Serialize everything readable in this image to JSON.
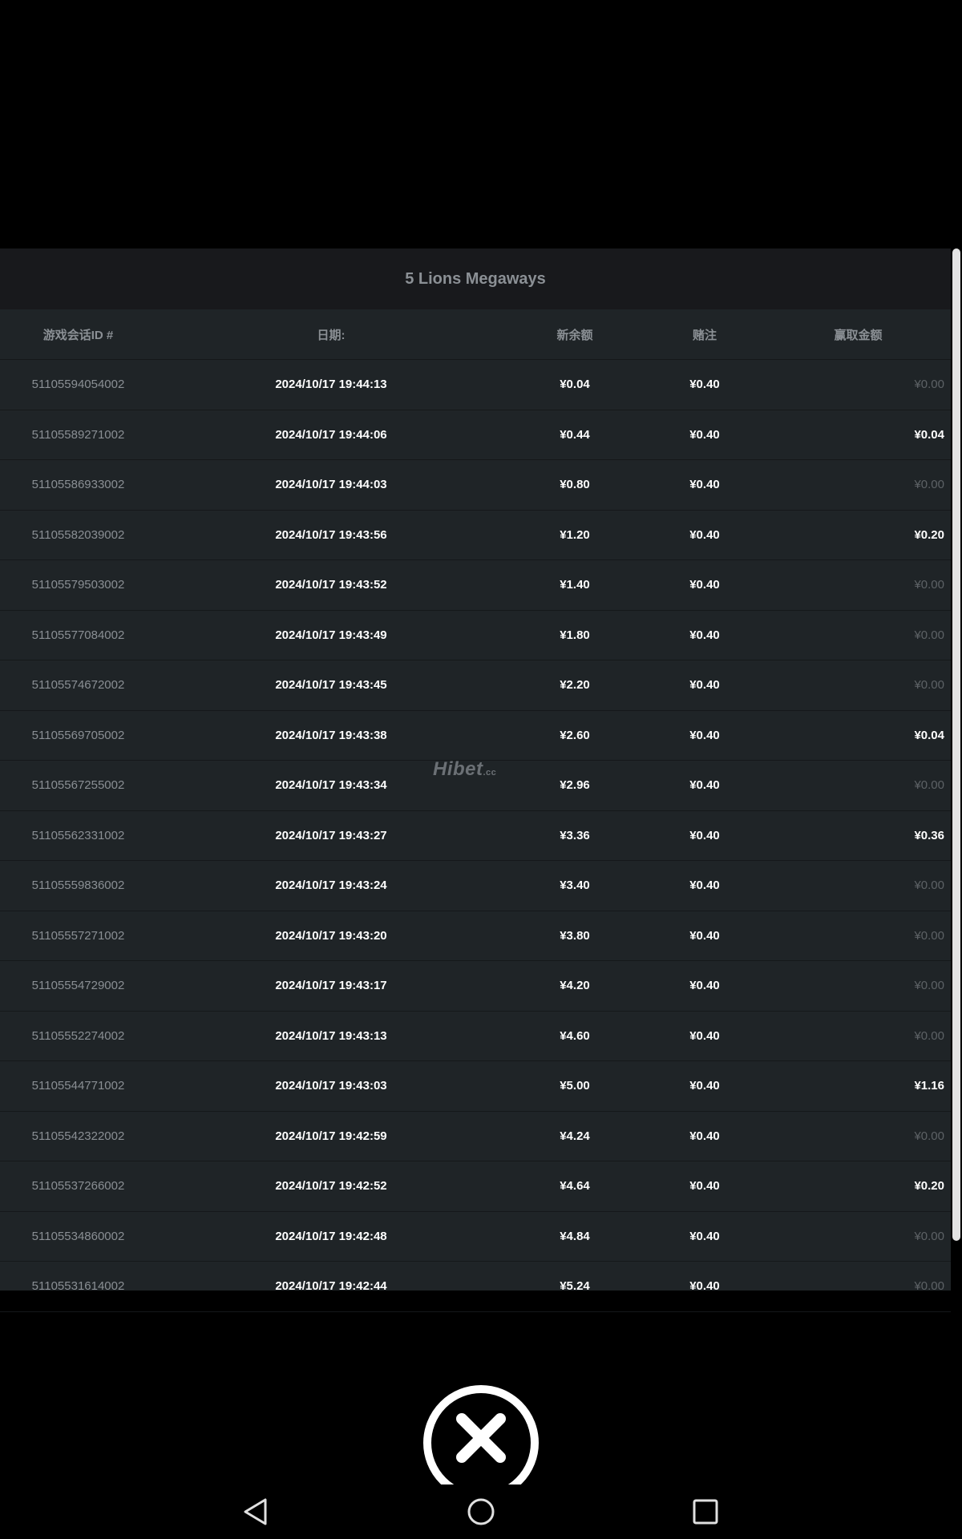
{
  "panel": {
    "title": "5 Lions Megaways"
  },
  "table": {
    "headers": {
      "session_id": "游戏会话ID #",
      "date": "日期:",
      "new_balance": "新余额",
      "bet": "赌注",
      "win": "赢取金额"
    },
    "rows": [
      {
        "id": "51105594054002",
        "date": "2024/10/17 19:44:13",
        "balance": "¥0.04",
        "bet": "¥0.40",
        "win": "¥0.00"
      },
      {
        "id": "51105589271002",
        "date": "2024/10/17 19:44:06",
        "balance": "¥0.44",
        "bet": "¥0.40",
        "win": "¥0.04"
      },
      {
        "id": "51105586933002",
        "date": "2024/10/17 19:44:03",
        "balance": "¥0.80",
        "bet": "¥0.40",
        "win": "¥0.00"
      },
      {
        "id": "51105582039002",
        "date": "2024/10/17 19:43:56",
        "balance": "¥1.20",
        "bet": "¥0.40",
        "win": "¥0.20"
      },
      {
        "id": "51105579503002",
        "date": "2024/10/17 19:43:52",
        "balance": "¥1.40",
        "bet": "¥0.40",
        "win": "¥0.00"
      },
      {
        "id": "51105577084002",
        "date": "2024/10/17 19:43:49",
        "balance": "¥1.80",
        "bet": "¥0.40",
        "win": "¥0.00"
      },
      {
        "id": "51105574672002",
        "date": "2024/10/17 19:43:45",
        "balance": "¥2.20",
        "bet": "¥0.40",
        "win": "¥0.00"
      },
      {
        "id": "51105569705002",
        "date": "2024/10/17 19:43:38",
        "balance": "¥2.60",
        "bet": "¥0.40",
        "win": "¥0.04"
      },
      {
        "id": "51105567255002",
        "date": "2024/10/17 19:43:34",
        "balance": "¥2.96",
        "bet": "¥0.40",
        "win": "¥0.00"
      },
      {
        "id": "51105562331002",
        "date": "2024/10/17 19:43:27",
        "balance": "¥3.36",
        "bet": "¥0.40",
        "win": "¥0.36"
      },
      {
        "id": "51105559836002",
        "date": "2024/10/17 19:43:24",
        "balance": "¥3.40",
        "bet": "¥0.40",
        "win": "¥0.00"
      },
      {
        "id": "51105557271002",
        "date": "2024/10/17 19:43:20",
        "balance": "¥3.80",
        "bet": "¥0.40",
        "win": "¥0.00"
      },
      {
        "id": "51105554729002",
        "date": "2024/10/17 19:43:17",
        "balance": "¥4.20",
        "bet": "¥0.40",
        "win": "¥0.00"
      },
      {
        "id": "51105552274002",
        "date": "2024/10/17 19:43:13",
        "balance": "¥4.60",
        "bet": "¥0.40",
        "win": "¥0.00"
      },
      {
        "id": "51105544771002",
        "date": "2024/10/17 19:43:03",
        "balance": "¥5.00",
        "bet": "¥0.40",
        "win": "¥1.16"
      },
      {
        "id": "51105542322002",
        "date": "2024/10/17 19:42:59",
        "balance": "¥4.24",
        "bet": "¥0.40",
        "win": "¥0.00"
      },
      {
        "id": "51105537266002",
        "date": "2024/10/17 19:42:52",
        "balance": "¥4.64",
        "bet": "¥0.40",
        "win": "¥0.20"
      },
      {
        "id": "51105534860002",
        "date": "2024/10/17 19:42:48",
        "balance": "¥4.84",
        "bet": "¥0.40",
        "win": "¥0.00"
      },
      {
        "id": "51105531614002",
        "date": "2024/10/17 19:42:44",
        "balance": "¥5.24",
        "bet": "¥0.40",
        "win": "¥0.00"
      }
    ]
  },
  "watermark": {
    "text": "Hibet",
    "suffix": ".cc"
  },
  "icons": {
    "close": "close-icon",
    "back": "back-triangle-icon",
    "home": "home-circle-icon",
    "recents": "recents-square-icon"
  },
  "colors": {
    "panel_bg": "#1f2427",
    "title_bg": "#18191c",
    "muted_text": "#8b9095",
    "zero_win_text": "#5d6266"
  }
}
